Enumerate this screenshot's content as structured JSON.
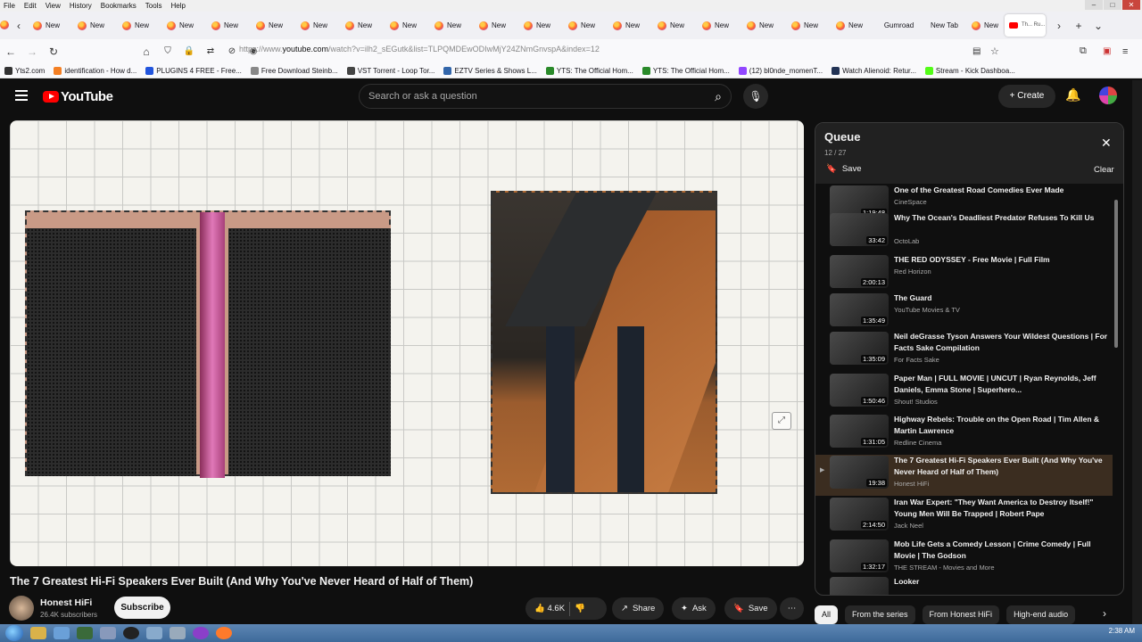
{
  "menubar": {
    "items": [
      "File",
      "Edit",
      "View",
      "History",
      "Bookmarks",
      "Tools",
      "Help"
    ]
  },
  "tabs": {
    "items": [
      "New",
      "New",
      "New",
      "New",
      "New",
      "New",
      "New",
      "New",
      "New",
      "New",
      "New",
      "New",
      "New",
      "New",
      "New",
      "New",
      "New",
      "New",
      "New"
    ],
    "gumroad": "Gumroad",
    "newtab": "New Tab",
    "last_new": "New",
    "active_title": "Th... Ru..."
  },
  "urlbar": {
    "prefix": "https://www.",
    "domain": "youtube.com",
    "rest": "/watch?v=ilh2_sEGutk&list=TLPQMDEwODIwMjY24ZNmGnvspA&index=12"
  },
  "bookmarks": [
    {
      "label": "Yts2.com",
      "color": "#333333"
    },
    {
      "label": "identification - How d...",
      "color": "#f48024"
    },
    {
      "label": "PLUGINS 4 FREE - Free...",
      "color": "#2255dd"
    },
    {
      "label": "Free Download Steinb...",
      "color": "#888888"
    },
    {
      "label": "VST Torrent - Loop Tor...",
      "color": "#444444"
    },
    {
      "label": "EZTV Series & Shows L...",
      "color": "#3366aa"
    },
    {
      "label": "YTS: The Official Hom...",
      "color": "#2a8a2a"
    },
    {
      "label": "YTS: The Official Hom...",
      "color": "#2a8a2a"
    },
    {
      "label": "(12) bl0nde_momenT...",
      "color": "#9146ff"
    },
    {
      "label": "Watch Alienoid: Retur...",
      "color": "#223355"
    },
    {
      "label": "Stream - Kick Dashboa...",
      "color": "#53fc18"
    }
  ],
  "yt": {
    "logo": "YouTube",
    "search_placeholder": "Search or ask a question",
    "create": "Create"
  },
  "video": {
    "title": "The 7 Greatest Hi-Fi Speakers Ever Built (And Why You've Never Heard of Half of Them)",
    "channel": "Honest HiFi",
    "subscribers": "26.4K subscribers",
    "subscribe": "Subscribe",
    "likes": "4.6K",
    "share": "Share",
    "ask": "Ask",
    "save": "Save"
  },
  "queue": {
    "title": "Queue",
    "count": "12 / 27",
    "save": "Save",
    "clear": "Clear",
    "items": [
      {
        "title": "One of the Greatest Road Comedies Ever Made",
        "channel": "CineSpace",
        "duration": "1:19:48",
        "current": false
      },
      {
        "title": "Why The Ocean's Deadliest Predator Refuses To Kill Us",
        "channel": "OctoLab",
        "duration": "33:42",
        "current": false
      },
      {
        "title": "THE RED ODYSSEY - Free Movie | Full Film",
        "channel": "Red Horizon",
        "duration": "2:00:13",
        "current": false
      },
      {
        "title": "The Guard",
        "channel": "YouTube Movies & TV",
        "duration": "1:35:49",
        "current": false
      },
      {
        "title": "Neil deGrasse Tyson Answers Your Wildest Questions | For Facts Sake Compilation",
        "channel": "For Facts Sake",
        "duration": "1:35:09",
        "current": false
      },
      {
        "title": "Paper Man | FULL MOVIE | UNCUT | Ryan Reynolds, Jeff Daniels, Emma Stone | Superhero...",
        "channel": "Shout! Studios",
        "duration": "1:50:46",
        "current": false
      },
      {
        "title": "Highway Rebels: Trouble on the Open Road | Tim Allen & Martin Lawrence",
        "channel": "Redline Cinema",
        "duration": "1:31:05",
        "current": false
      },
      {
        "title": "The 7 Greatest Hi-Fi Speakers Ever Built (And Why You've Never Heard of Half of Them)",
        "channel": "Honest HiFi",
        "duration": "19:38",
        "current": true
      },
      {
        "title": "Iran War Expert: \"They Want America to Destroy Itself!\" Young Men Will Be Trapped | Robert Pape",
        "channel": "Jack Neel",
        "duration": "2:14:50",
        "current": false
      },
      {
        "title": "Mob Life Gets a Comedy Lesson | Crime Comedy | Full Movie | The Godson",
        "channel": "THE STREAM - Movies and More",
        "duration": "1:32:17",
        "current": false
      },
      {
        "title": "Looker",
        "channel": "",
        "duration": "",
        "current": false
      }
    ]
  },
  "chips": [
    "All",
    "From the series",
    "From Honest HiFi",
    "High-end audio"
  ],
  "taskbar": {
    "time": "2:38 AM"
  }
}
